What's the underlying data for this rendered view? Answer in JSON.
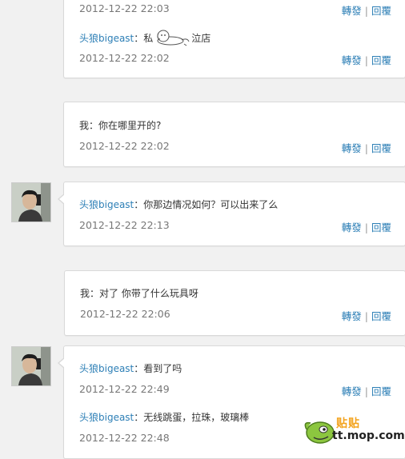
{
  "actions": {
    "forward": "轉發",
    "reply": "回覆",
    "sep": "|"
  },
  "cards": [
    {
      "time": "2012-12-22 22:03"
    },
    {
      "name": "头狼bigeast",
      "text_before": "：私",
      "text_after": "泣店",
      "time": "2012-12-22 22:02"
    },
    {
      "text": "我：你在哪里开的?",
      "time": "2012-12-22 22:02"
    },
    {
      "name": "头狼bigeast",
      "text": "：你那边情况如何？可以出来了么",
      "time": "2012-12-22 22:13"
    },
    {
      "text": "我：对了 你带了什么玩具呀",
      "time": "2012-12-22 22:06"
    },
    {
      "name": "头狼bigeast",
      "text": "：看到了吗",
      "time": "2012-12-22 22:49"
    },
    {
      "name": "头狼bigeast",
      "text": "：无线跳蛋，拉珠，玻璃棒",
      "time": "2012-12-22 22:48"
    }
  ],
  "watermark": {
    "cn": "贴贴",
    "site": "tt.mop.com"
  }
}
